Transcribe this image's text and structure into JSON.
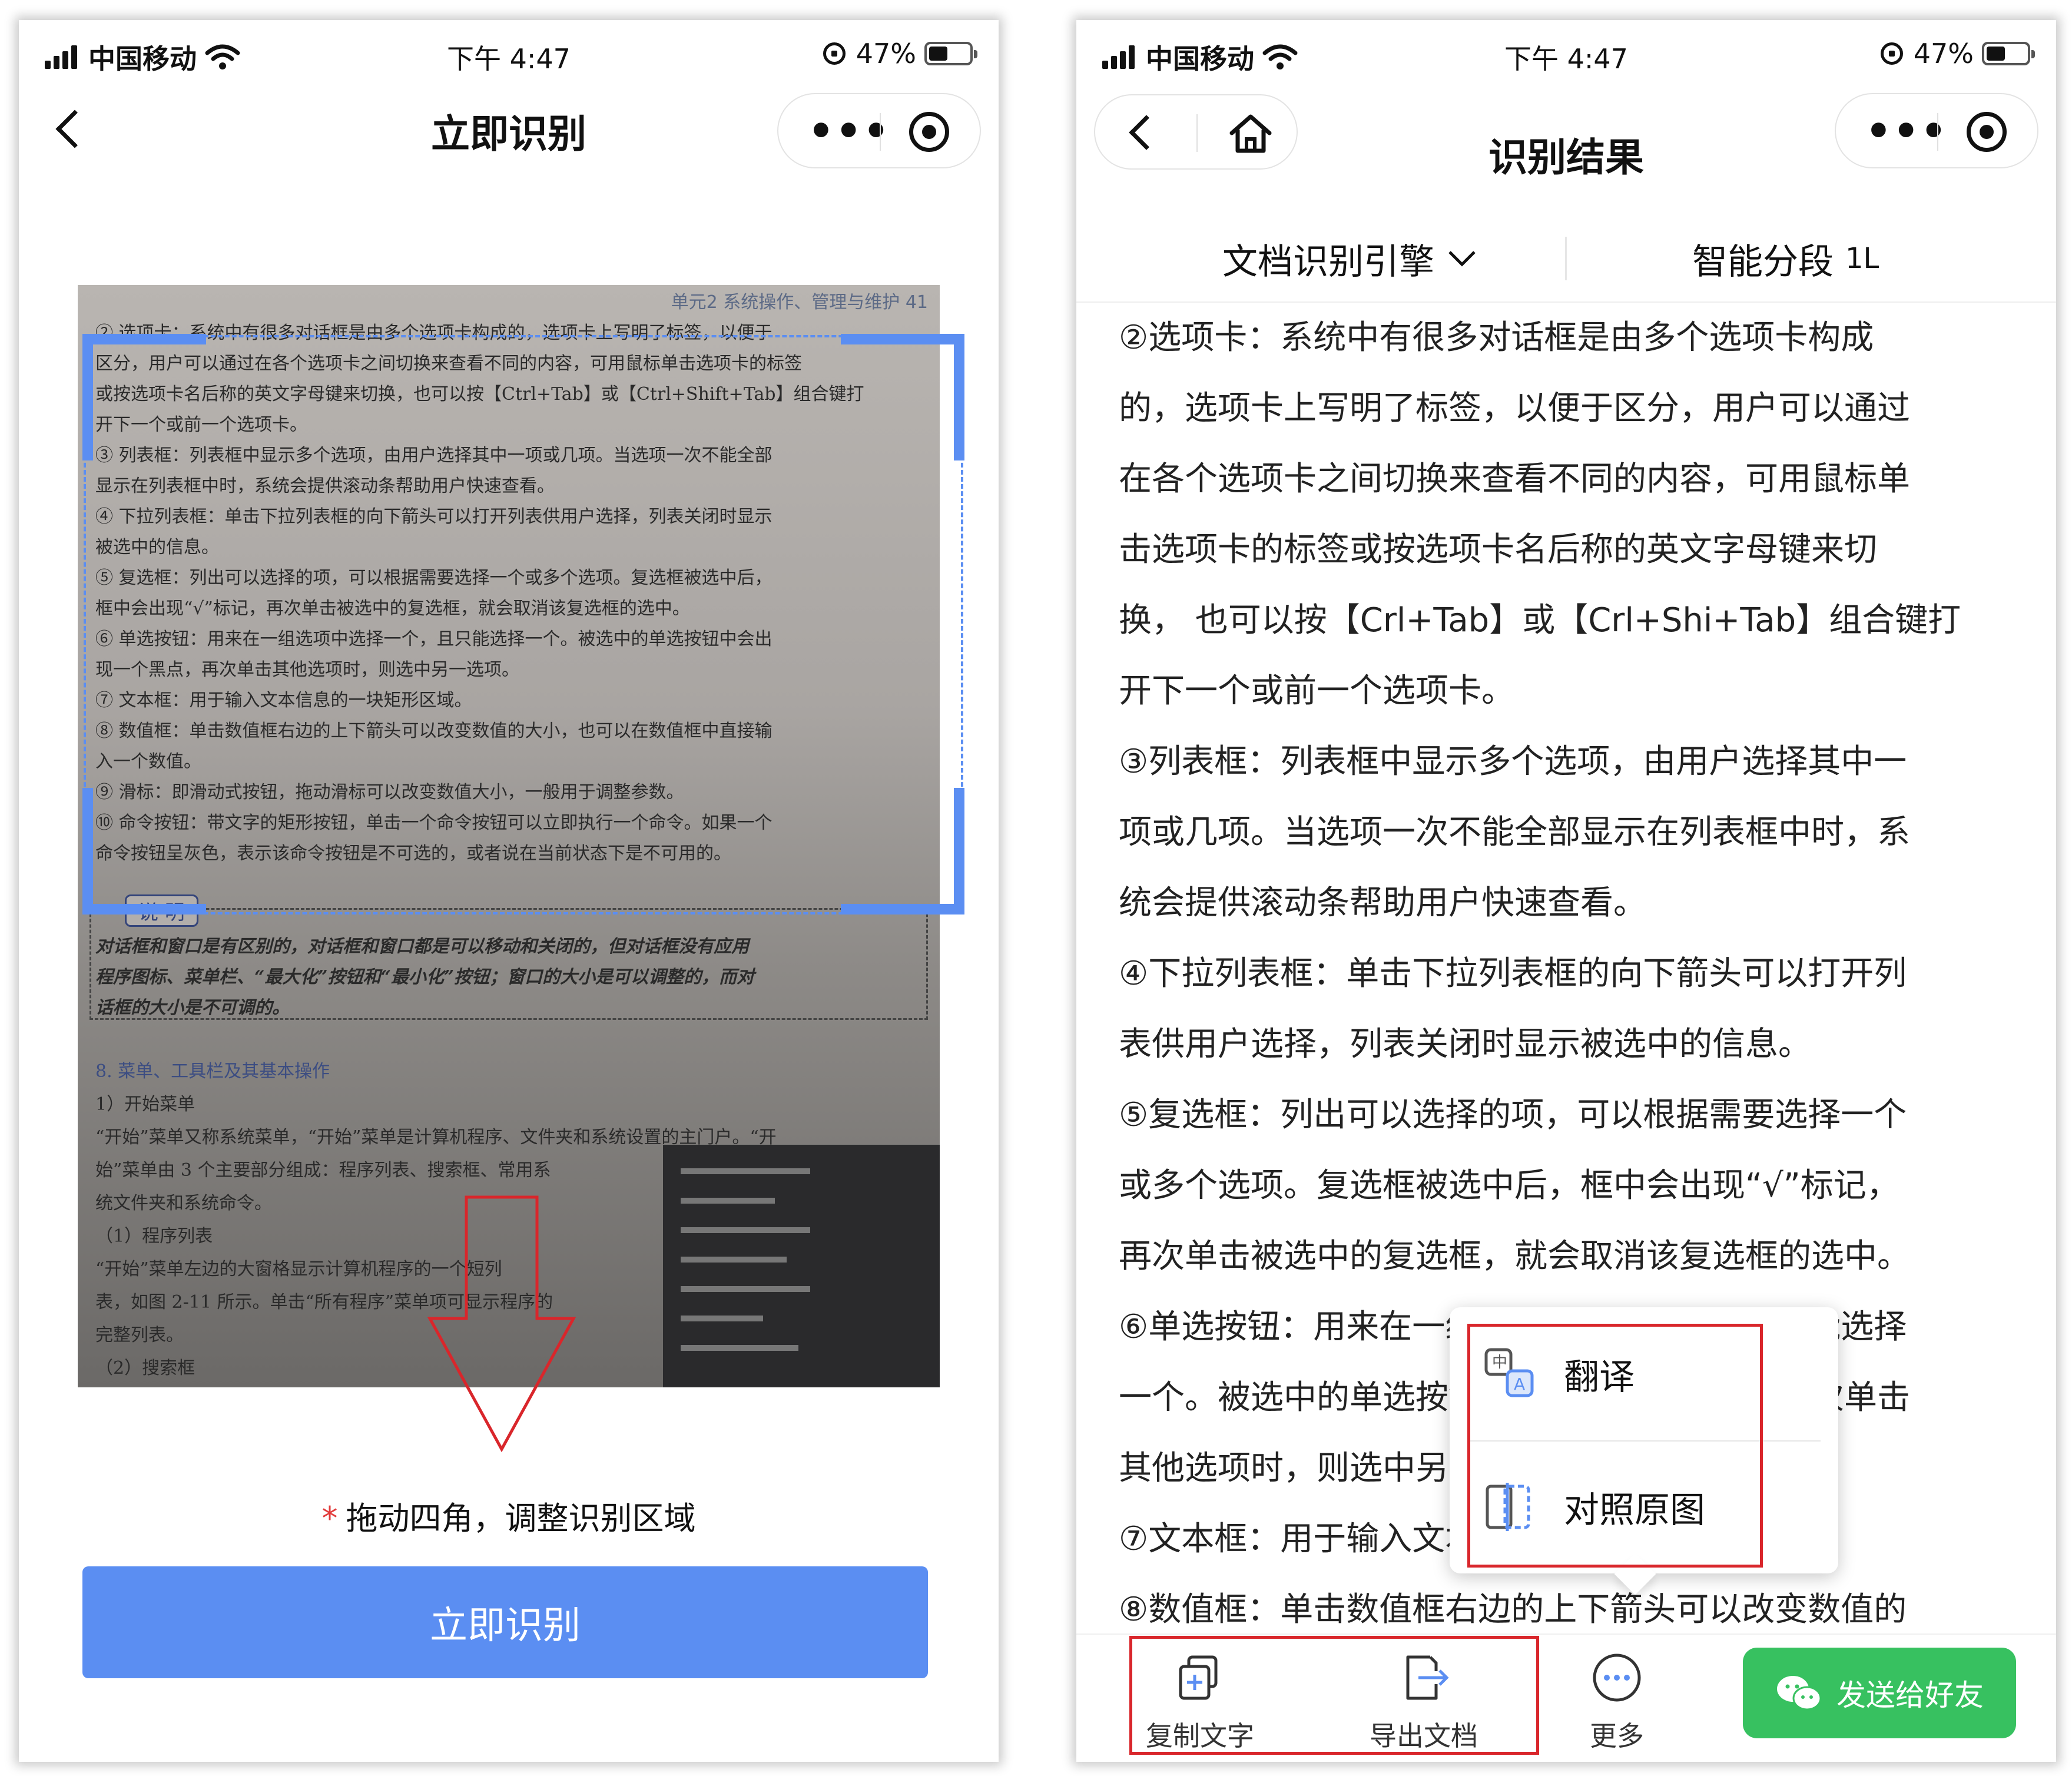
{
  "status_bar": {
    "carrier": "中国移动",
    "time": "下午 4:47",
    "battery": "47%",
    "battery_level": 0.47
  },
  "left_screen": {
    "title": "立即识别",
    "photo": {
      "header": "单元2 系统操作、管理与维护  41",
      "lines": [
        "② 选项卡：系统中有很多对话框是由多个选项卡构成的，选项卡上写明了标签，以便于",
        "区分，用户可以通过在各个选项卡之间切换来查看不同的内容，可用鼠标单击选项卡的标签",
        "或按选项卡名后称的英文字母键来切换，也可以按【Ctrl+Tab】或【Ctrl+Shift+Tab】组合键打",
        "开下一个或前一个选项卡。",
        "③ 列表框：列表框中显示多个选项，由用户选择其中一项或几项。当选项一次不能全部",
        "显示在列表框中时，系统会提供滚动条帮助用户快速查看。",
        "④ 下拉列表框：单击下拉列表框的向下箭头可以打开列表供用户选择，列表关闭时显示",
        "被选中的信息。",
        "⑤ 复选框：列出可以选择的项，可以根据需要选择一个或多个选项。复选框被选中后，",
        "框中会出现“√”标记，再次单击被选中的复选框，就会取消该复选框的选中。",
        "⑥ 单选按钮：用来在一组选项中选择一个，且只能选择一个。被选中的单选按钮中会出",
        "现一个黑点，再次单击其他选项时，则选中另一选项。",
        "⑦ 文本框：用于输入文本信息的一块矩形区域。",
        "⑧ 数值框：单击数值框右边的上下箭头可以改变数值的大小，也可以在数值框中直接输",
        "入一个数值。",
        "⑨ 滑标：即滑动式按钮，拖动滑标可以改变数值大小，一般用于调整参数。",
        "⑩ 命令按钮：带文字的矩形按钮，单击一个命令按钮可以立即执行一个命令。如果一个",
        "命令按钮呈灰色，表示该命令按钮是不可选的，或者说在当前状态下是不可用的。"
      ],
      "note_label": "说 明",
      "note_lines": [
        "对话框和窗口是有区别的，对话框和窗口都是可以移动和关闭的，但对话框没有应用",
        "程序图标、菜单栏、“最大化”按钮和“最小化”按钮；窗口的大小是可以调整的，而对",
        "话框的大小是不可调的。"
      ],
      "lower_lines": [
        "8. 菜单、工具栏及其基本操作",
        "1）开始菜单",
        "“开始”菜单又称系统菜单，“开始”菜单是计算机程序、文件夹和系统设置的主门户。“开",
        "始”菜单由 3 个主要部分组成：程序列表、搜索框、常用系",
        "统文件夹和系统命令。",
        "（1）程序列表",
        "“开始”菜单左边的大窗格显示计算机程序的一个短列",
        "表，如图 2-11 所示。单击“所有程序”菜单项可显示程序的",
        "完整列表。",
        "（2）搜索框"
      ]
    },
    "hint": "拖动四角，调整识别区域",
    "hint_star": "*",
    "primary_button": "立即识别"
  },
  "right_screen": {
    "title": "识别结果",
    "engine_option": "文档识别引擎",
    "segment_option": "智能分段",
    "segment_icon": "1L",
    "result_lines": [
      "②选项卡：系统中有很多对话框是由多个选项卡构成",
      "的，选项卡上写明了标签，以便于区分，用户可以通过",
      "在各个选项卡之间切换来查看不同的内容，可用鼠标单",
      "击选项卡的标签或按选项卡名后称的英文字母键来切",
      "换， 也可以按【Crl+Tab】或【Crl+Shi+Tab】组合键打",
      "开下一个或前一个选项卡。",
      "③列表框：列表框中显示多个选项，由用户选择其中一",
      "项或几项。当选项一次不能全部显示在列表框中时，系",
      "统会提供滚动条帮助用户快速查看。",
      "④下拉列表框：单击下拉列表框的向下箭头可以打开列",
      "表供用户选择，列表关闭时显示被选中的信息。",
      "⑤复选框：列出可以选择的项，可以根据需要选择一个",
      "或多个选项。复选框被选中后，框中会出现“√”标记，",
      "再次单击被选中的复选框，就会取消该复选框的选中。",
      "⑥单选按钮：用来在一组选项中选择一个，且只能选择",
      "一个。被选中的单选按钮中会出现一个黑点，再次单击",
      "其他选项时，则选中另一选项。",
      "⑦文本框：用于输入文本信息的一块矩形区域。",
      "⑧数值框：单击数值框右边的上下箭头可以改变数值的"
    ],
    "context_menu": {
      "translate": "翻译",
      "compare": "对照原图"
    },
    "bottom_bar": {
      "copy": "复制文字",
      "export": "导出文档",
      "more": "更多",
      "send": "发送给好友"
    }
  },
  "colors": {
    "accent_blue": "#5b8ef2",
    "wechat_green": "#37c160",
    "highlight_red": "#d9262b",
    "hint_star_red": "#e23b3b"
  }
}
